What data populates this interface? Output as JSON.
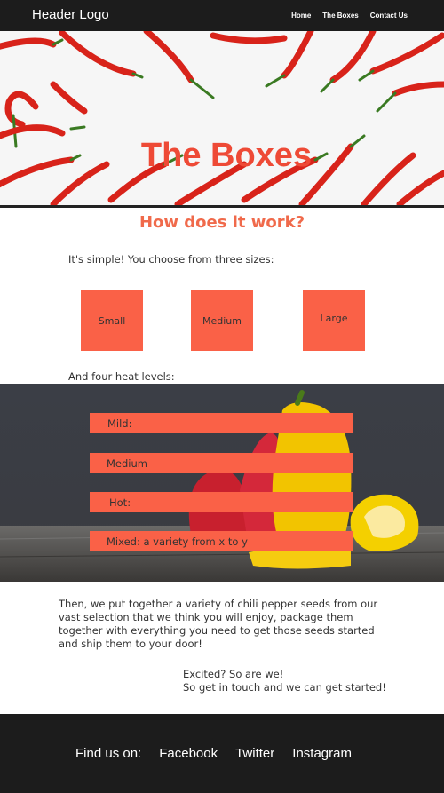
{
  "header": {
    "logo": "Header Logo",
    "nav": [
      "Home",
      "The Boxes",
      "Contact Us"
    ]
  },
  "hero": {
    "title": "The Boxes"
  },
  "how": {
    "title": "How does it work?",
    "intro": "It's simple! You choose from three sizes:",
    "sizes": [
      "Small",
      "Medium",
      "Large"
    ],
    "heat_intro": "And four heat levels:",
    "heat_levels": [
      "Mild:",
      "Medium",
      "Hot:",
      "Mixed: a variety from x to y"
    ]
  },
  "body": {
    "paragraph_lines": [
      "Then, we put together a variety of chili pepper seeds from our",
      "vast selection that we think you will enjoy, package them",
      "together with everything you need to get those seeds started",
      "and ship them to your door!"
    ],
    "excited_lines": [
      "Excited? So are we!",
      "So get in touch and we can get started!"
    ]
  },
  "footer": {
    "label": "Find us on:",
    "links": [
      "Facebook",
      "Twitter",
      "Instagram"
    ]
  },
  "colors": {
    "accent": "#fa6147",
    "title_red": "#ee4a36",
    "header_bg": "#1c1c1c"
  }
}
